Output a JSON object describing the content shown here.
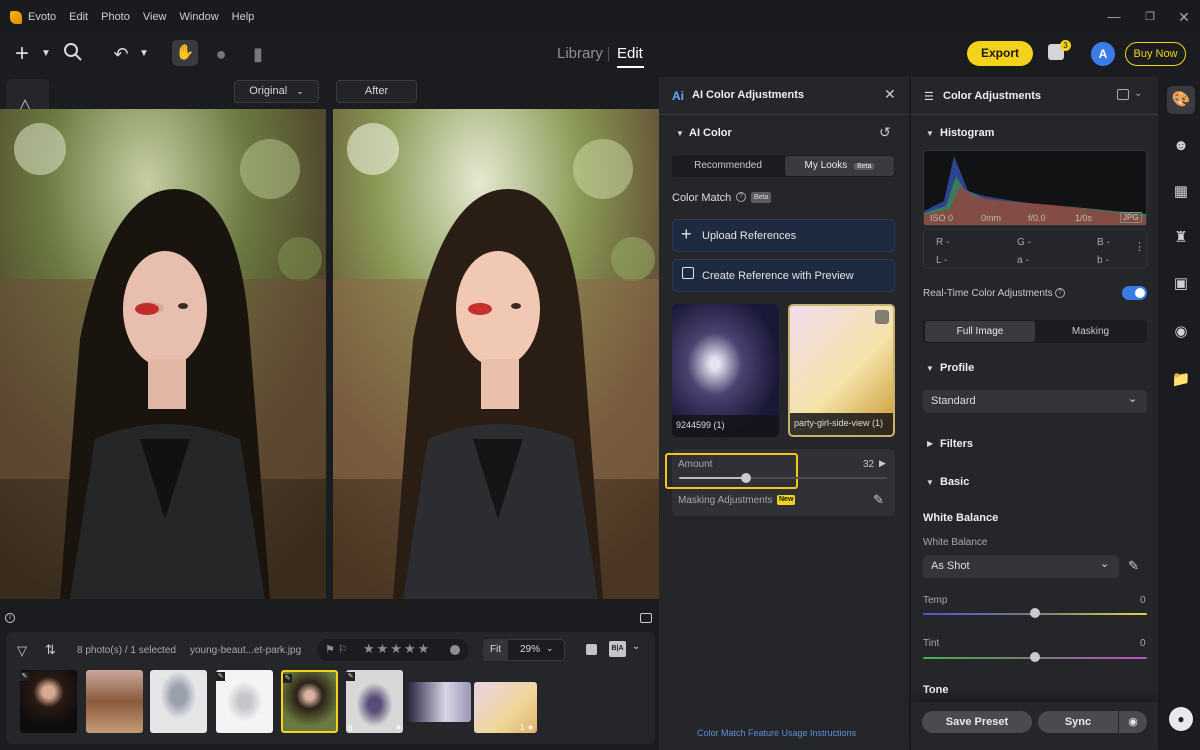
{
  "menubar": {
    "app_name": "Evoto",
    "items": [
      "Edit",
      "Photo",
      "View",
      "Window",
      "Help"
    ]
  },
  "toolbar": {
    "library_tab": "Library",
    "edit_tab": "Edit",
    "export_label": "Export",
    "notification_count": "3",
    "avatar_letter": "A",
    "buy_now_label": "Buy Now"
  },
  "compare": {
    "original_label": "Original",
    "after_label": "After"
  },
  "filmstrip": {
    "photo_count": "8 photo(s) / 1 selected",
    "file_name": "young-beaut...et-park.jpg",
    "fit_label": "Fit",
    "zoom": "29%",
    "ba_label": "B|A",
    "thumb_badges": [
      "1",
      "6",
      "1"
    ]
  },
  "ai_panel": {
    "title": "AI Color Adjustments",
    "section": "AI Color",
    "tab_recommended": "Recommended",
    "tab_my_looks": "My Looks",
    "beta_badge": "Beta",
    "color_match_label": "Color Match",
    "upload_references": "Upload References",
    "create_reference": "Create Reference with Preview",
    "ref1_name": "9244599 (1)",
    "ref2_name": "party-girl-side-view (1)",
    "amount_label": "Amount",
    "amount_value": "32",
    "amount_fraction": 0.32,
    "masking_adjustments": "Masking Adjustments",
    "new_badge": "New",
    "footer_link": "Color Match Feature Usage Instructions"
  },
  "color_panel": {
    "title": "Color Adjustments",
    "histogram_label": "Histogram",
    "iso": "ISO 0",
    "focal": "0mm",
    "aperture": "f/0.0",
    "shutter": "1/0s",
    "format": "JPG",
    "r_label": "R -",
    "g_label": "G -",
    "b_label": "B -",
    "l_label": "L -",
    "a_label": "a -",
    "b2_label": "b -",
    "realtime_label": "Real-Time Color Adjustments",
    "tab_full_image": "Full Image",
    "tab_masking": "Masking",
    "profile_label": "Profile",
    "profile_value": "Standard",
    "filters_label": "Filters",
    "basic_label": "Basic",
    "white_balance_heading": "White Balance",
    "white_balance_label": "White Balance",
    "white_balance_value": "As Shot",
    "temp_label": "Temp",
    "temp_value": "0",
    "tint_label": "Tint",
    "tint_value": "0",
    "tone_label": "Tone",
    "save_preset": "Save Preset",
    "sync": "Sync"
  }
}
